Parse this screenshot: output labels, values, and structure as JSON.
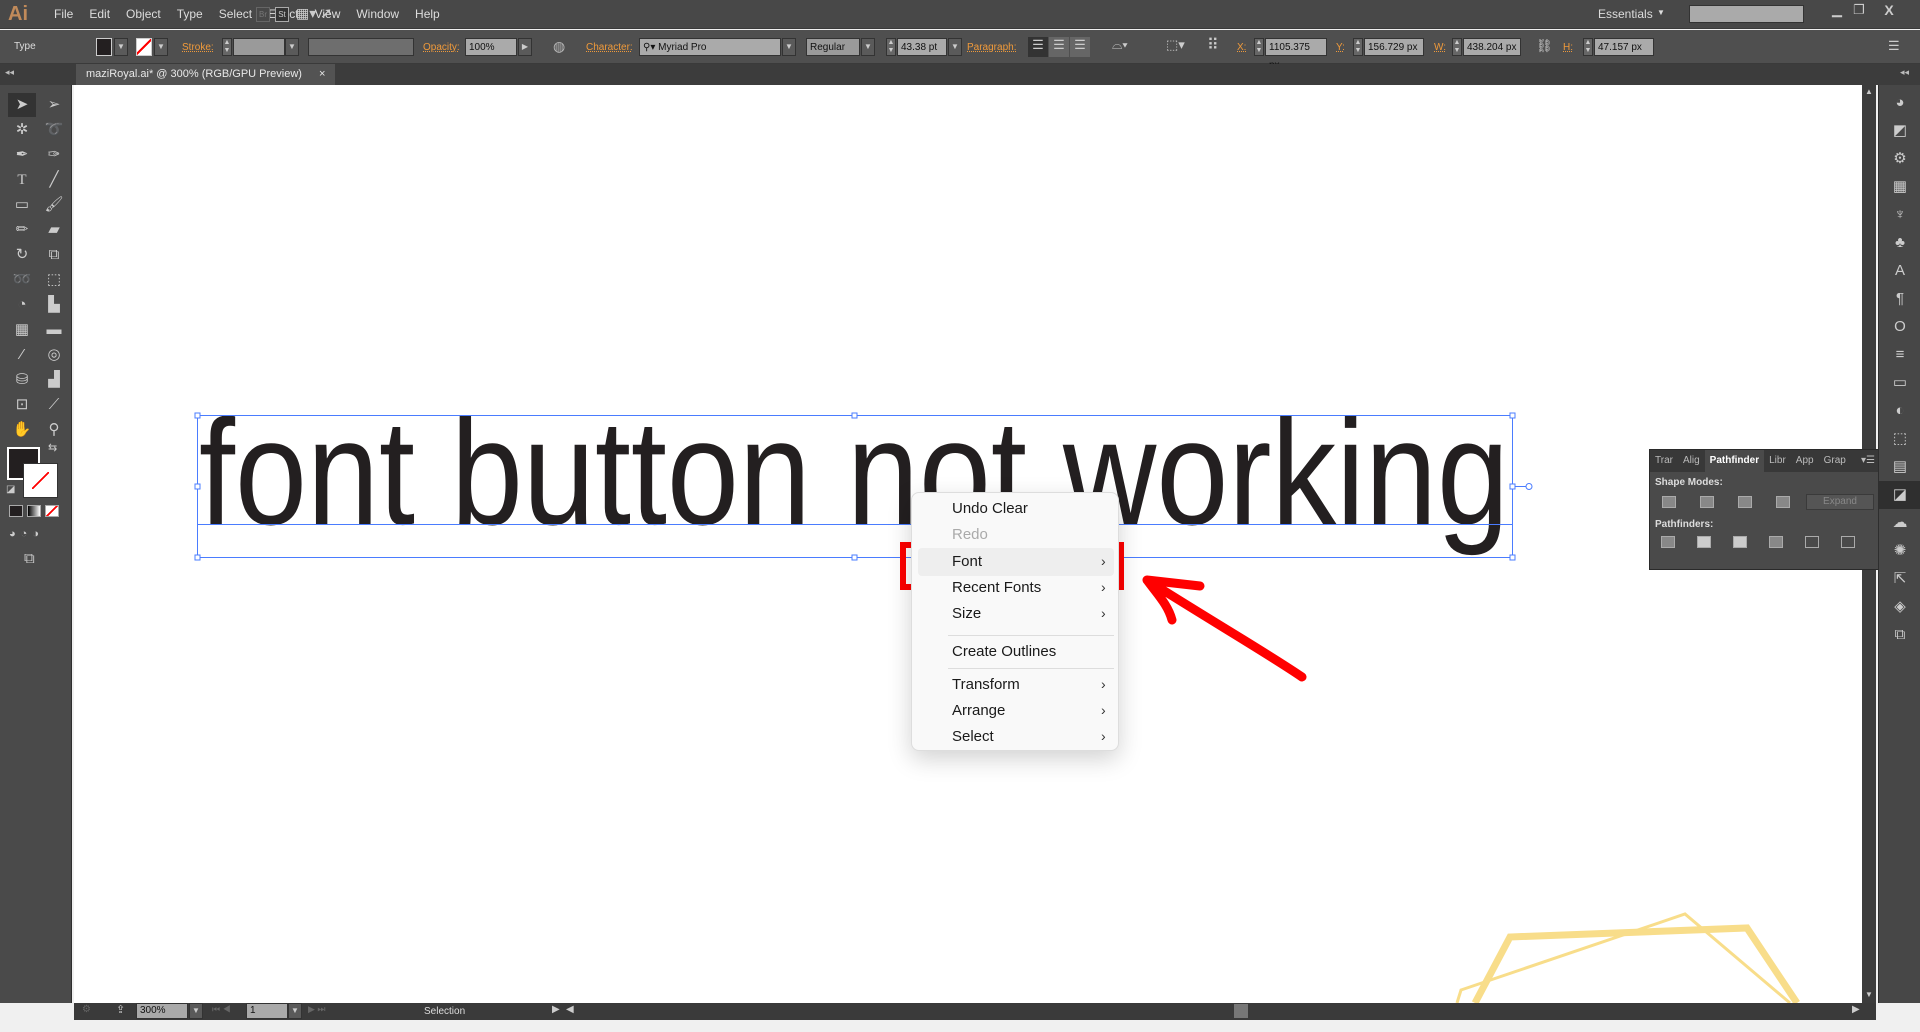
{
  "app": {
    "logo": "Ai",
    "menu": [
      "File",
      "Edit",
      "Object",
      "Type",
      "Select",
      "Effect",
      "View",
      "Window",
      "Help"
    ],
    "bridge": "Br",
    "stock": "St",
    "workspace": "Essentials",
    "search_placeholder": ""
  },
  "control": {
    "mode": "Type",
    "stroke_label": "Stroke:",
    "opacity_label": "Opacity:",
    "opacity": "100%",
    "character_label": "Character:",
    "font": "Myriad Pro",
    "style": "Regular",
    "size": "43.38 pt",
    "paragraph_label": "Paragraph:",
    "x_label": "X:",
    "x": "1105.375 px",
    "y_label": "Y:",
    "y": "156.729 px",
    "w_label": "W:",
    "w": "438.204 px",
    "h_label": "H:",
    "h": "47.157 px"
  },
  "document": {
    "tab": "maziRoyal.ai* @ 300% (RGB/GPU Preview)",
    "close": "×",
    "text": "font button not working"
  },
  "context_menu": {
    "items": [
      {
        "label": "Undo Clear",
        "enabled": true,
        "submenu": false
      },
      {
        "label": "Redo",
        "enabled": false,
        "submenu": false
      },
      {
        "label": "Font",
        "enabled": true,
        "submenu": true
      },
      {
        "label": "Recent Fonts",
        "enabled": true,
        "submenu": true
      },
      {
        "label": "Size",
        "enabled": true,
        "submenu": true
      },
      {
        "label": "Create Outlines",
        "enabled": true,
        "submenu": false
      },
      {
        "label": "Transform",
        "enabled": true,
        "submenu": true
      },
      {
        "label": "Arrange",
        "enabled": true,
        "submenu": true
      },
      {
        "label": "Select",
        "enabled": true,
        "submenu": true
      }
    ],
    "chevron": "›"
  },
  "pathfinder": {
    "tabs": [
      "Trar",
      "Alig",
      "Pathfinder",
      "Libr",
      "App",
      "Grap"
    ],
    "shape_modes": "Shape Modes:",
    "expand": "Expand",
    "pathfinders": "Pathfinders:"
  },
  "status": {
    "zoom": "300%",
    "artboard": "1",
    "tool": "Selection"
  },
  "colors": {
    "annotation": "#ff0000",
    "selection": "#4a7cff",
    "decoration": "#f8dd8a"
  }
}
